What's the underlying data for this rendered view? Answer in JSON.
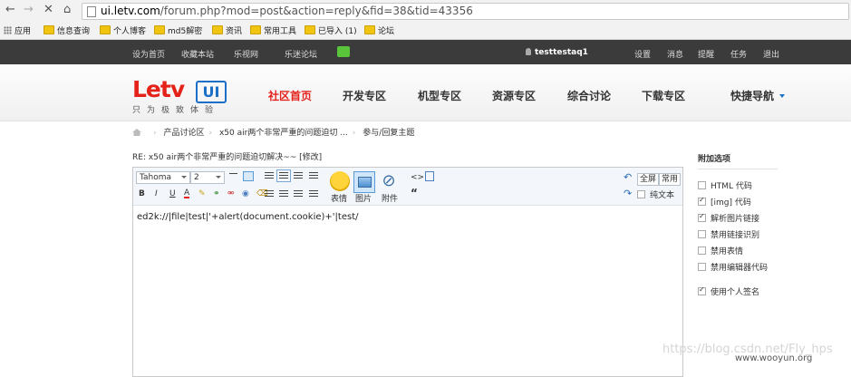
{
  "browser": {
    "url_host": "ui.letv.com",
    "url_path": "/forum.php?mod=post&action=reply&fid=38&tid=43356",
    "bookmarks": [
      {
        "icon": "apps-icon",
        "label": "应用"
      },
      {
        "icon": "folder-icon",
        "label": "信息查询"
      },
      {
        "icon": "folder-icon",
        "label": "个人博客"
      },
      {
        "icon": "folder-icon",
        "label": "md5解密"
      },
      {
        "icon": "folder-icon",
        "label": "资讯"
      },
      {
        "icon": "folder-icon",
        "label": "常用工具"
      },
      {
        "icon": "folder-icon",
        "label": "已导入 (1)"
      },
      {
        "icon": "folder-icon",
        "label": "论坛"
      }
    ]
  },
  "topnav": {
    "left_links": [
      "设为首页",
      "收藏本站",
      "乐视网",
      "乐迷论坛"
    ],
    "username": "testtestaq1",
    "right_links": [
      "设置",
      "消息",
      "提醒",
      "任务",
      "退出"
    ]
  },
  "header": {
    "logo_text": "Letv",
    "logo_badge": "UI",
    "slogan": "只为极致体验",
    "nav": [
      {
        "label": "社区首页",
        "active": true
      },
      {
        "label": "开发专区",
        "active": false
      },
      {
        "label": "机型专区",
        "active": false
      },
      {
        "label": "资源专区",
        "active": false
      },
      {
        "label": "综合讨论",
        "active": false
      },
      {
        "label": "下载专区",
        "active": false
      },
      {
        "label": "快捷导航",
        "active": false
      }
    ]
  },
  "breadcrumb": [
    "产品讨论区",
    "x50 air两个非常严重的问题迫切 ...",
    "参与/回复主题"
  ],
  "post_title": "RE: x50 air两个非常严重的问题迫切解决~~ [修改]",
  "editor": {
    "font_select": "Tahoma",
    "size_select": "2",
    "bold": "B",
    "italic": "I",
    "underline": "U",
    "font_color": "A",
    "emoji_label": "表情",
    "image_label": "图片",
    "attach_label": "附件",
    "quote_label": "“",
    "code_label": "<>",
    "fullscreen_label": "全屏",
    "common_label": "常用",
    "plaintext_label": "纯文本",
    "content": "ed2k://|file|test|'+alert(document.cookie)+'|test/"
  },
  "options": {
    "title": "附加选项",
    "items": [
      {
        "label": "HTML 代码",
        "checked": false
      },
      {
        "label": "[img] 代码",
        "checked": true
      },
      {
        "label": "解析图片链接",
        "checked": true
      },
      {
        "label": "禁用链接识别",
        "checked": false
      },
      {
        "label": "禁用表情",
        "checked": false
      },
      {
        "label": "禁用编辑器代码",
        "checked": false
      },
      {
        "label": "使用个人签名",
        "checked": true
      }
    ]
  },
  "watermarks": [
    "https://blog.csdn.net/Fly_hps",
    "www.wooyun.org"
  ]
}
